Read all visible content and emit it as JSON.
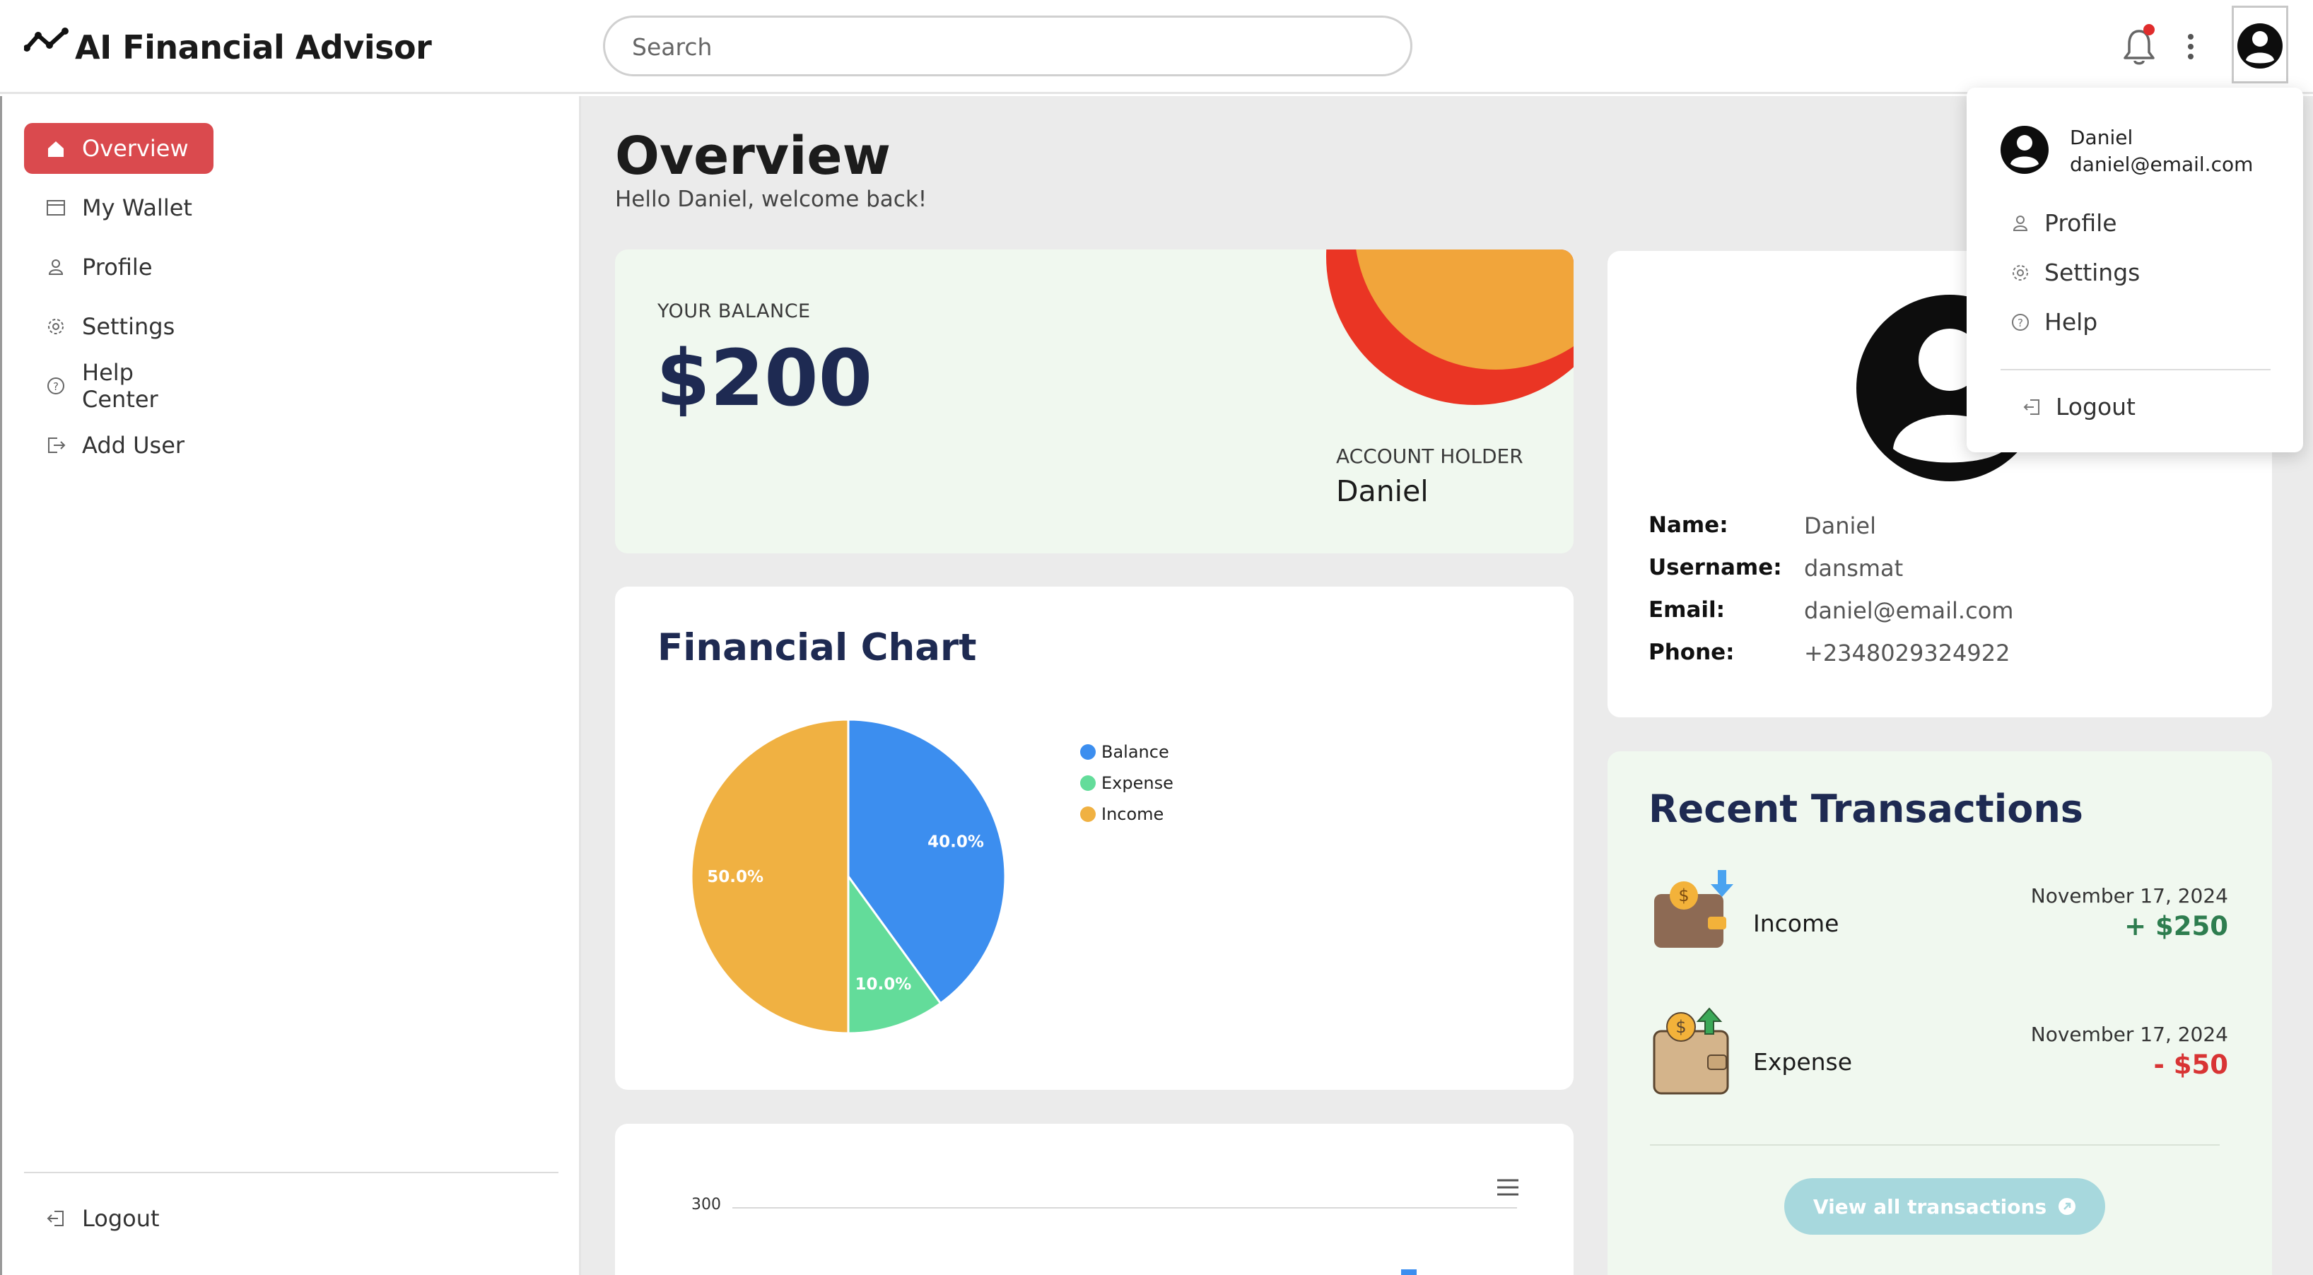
{
  "app": {
    "title": "AI Financial Advisor"
  },
  "search": {
    "placeholder": "Search"
  },
  "sidebar": {
    "items": [
      {
        "label": "Overview",
        "icon": "home-icon",
        "active": true
      },
      {
        "label": "My Wallet",
        "icon": "wallet-icon"
      },
      {
        "label": "Profile",
        "icon": "user-icon"
      },
      {
        "label": "Settings",
        "icon": "gear-icon"
      },
      {
        "label": "Help Center",
        "icon": "help-icon"
      },
      {
        "label": "Add User",
        "icon": "add-user-icon"
      }
    ],
    "logout_label": "Logout"
  },
  "main": {
    "title": "Overview",
    "subtitle": "Hello Daniel, welcome back!"
  },
  "balance": {
    "label": "YOUR BALANCE",
    "value": "$200",
    "holder_label": "ACCOUNT HOLDER",
    "holder_name": "Daniel"
  },
  "financial_chart": {
    "title": "Financial Chart"
  },
  "chart_data": [
    {
      "type": "pie",
      "title": "",
      "categories": [
        "Balance",
        "Expense",
        "Income"
      ],
      "values": [
        40.0,
        10.0,
        50.0
      ],
      "labels": [
        "40.0%",
        "10.0%",
        "50.0%"
      ],
      "colors": [
        "#3c8eef",
        "#63dc9a",
        "#f0b142"
      ],
      "legend": "top-right"
    },
    {
      "type": "bar",
      "title": "",
      "y_ticks": [
        "300"
      ],
      "note": ""
    }
  ],
  "profile": {
    "fields": [
      {
        "key": "Name:",
        "value": "Daniel"
      },
      {
        "key": "Username:",
        "value": "dansmat"
      },
      {
        "key": "Email:",
        "value": "daniel@email.com"
      },
      {
        "key": "Phone:",
        "value": "+2348029324922"
      }
    ]
  },
  "transactions": {
    "title": "Recent Transactions",
    "items": [
      {
        "type": "Income",
        "date": "November 17, 2024",
        "amount": "+ $250",
        "color": "#2e7d4f"
      },
      {
        "type": "Expense",
        "date": "November 17, 2024",
        "amount": "- $50",
        "color": "#d83434"
      }
    ],
    "view_all_label": "View all transactions"
  },
  "dropdown": {
    "name": "Daniel",
    "email": "daniel@email.com",
    "items": [
      {
        "label": "Profile",
        "icon": "user-icon"
      },
      {
        "label": "Settings",
        "icon": "gear-icon"
      },
      {
        "label": "Help",
        "icon": "help-icon"
      }
    ],
    "logout_label": "Logout"
  },
  "colors": {
    "accent_red": "#da4a4e",
    "navy": "#1e2a52",
    "mint_bg": "#f0f8ef"
  }
}
